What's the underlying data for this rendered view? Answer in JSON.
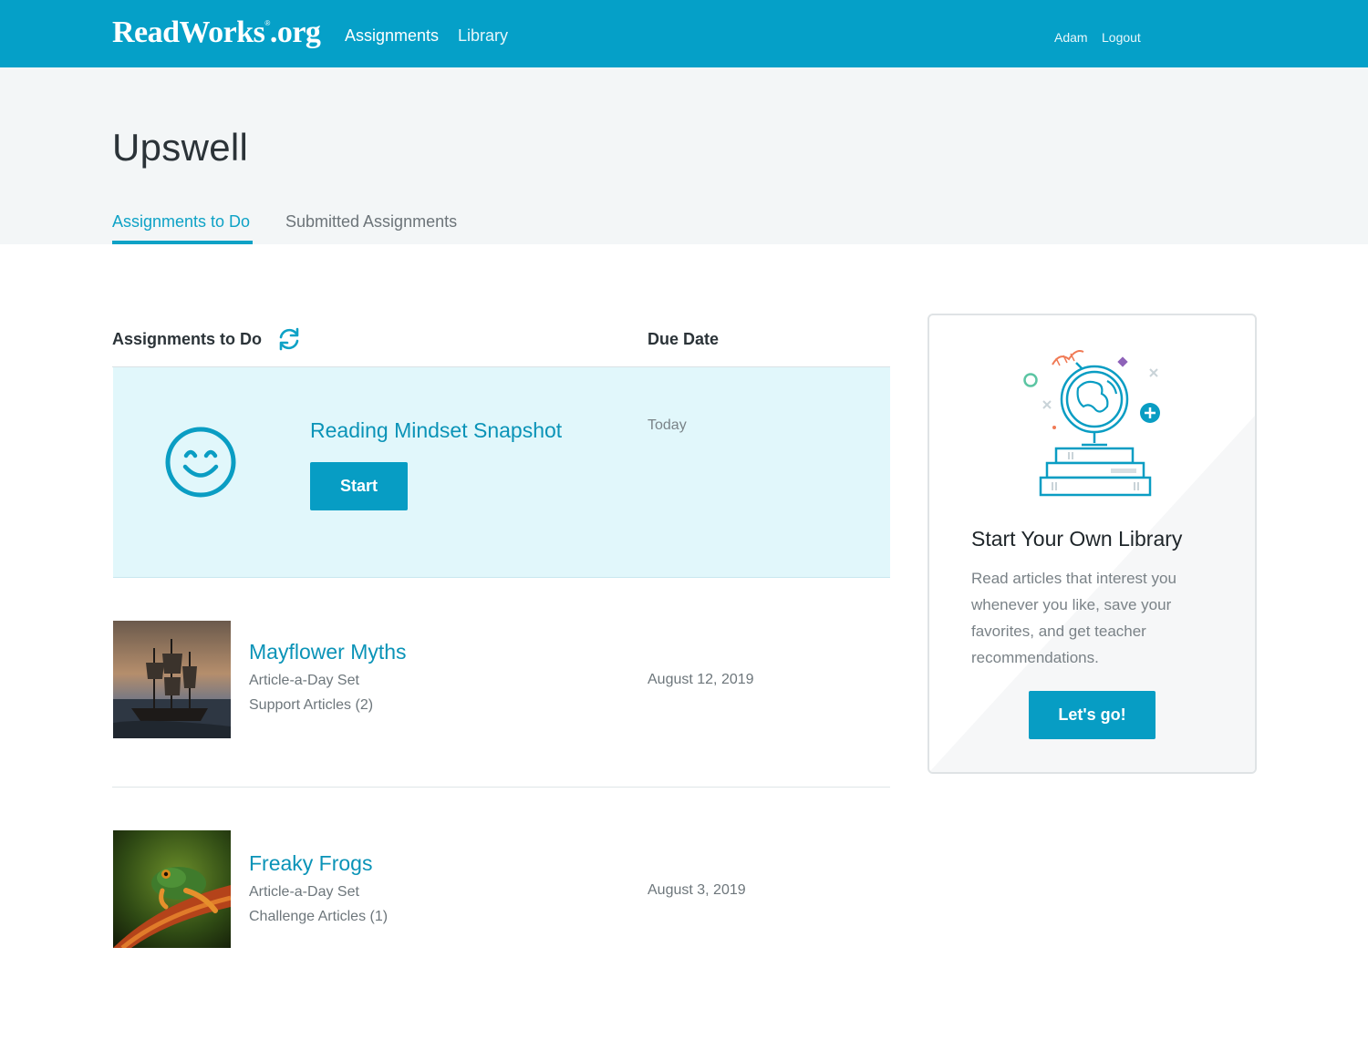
{
  "header": {
    "logo_text": "ReadWorks",
    "logo_reg": "®",
    "logo_suffix": ".org",
    "nav": {
      "assignments": "Assignments",
      "library": "Library"
    },
    "user": {
      "name": "Adam",
      "logout": "Logout"
    }
  },
  "page": {
    "title": "Upswell",
    "tabs": [
      {
        "label": "Assignments to Do",
        "active": true
      },
      {
        "label": "Submitted Assignments",
        "active": false
      }
    ]
  },
  "list": {
    "heading": "Assignments to Do",
    "due_heading": "Due Date",
    "featured": {
      "title": "Reading Mindset Snapshot",
      "button": "Start",
      "due": "Today",
      "icon": "smiley-face-icon"
    },
    "items": [
      {
        "title": "Mayflower Myths",
        "type": "Article-a-Day Set",
        "detail": "Support Articles (2)",
        "due": "August 12, 2019",
        "thumbnail": "ship-painting"
      },
      {
        "title": "Freaky Frogs",
        "type": "Article-a-Day Set",
        "detail": "Challenge Articles (1)",
        "due": "August 3, 2019",
        "thumbnail": "frog-photo"
      }
    ]
  },
  "sidebar_card": {
    "title": "Start Your Own Library",
    "text": "Read articles that interest you whenever you like, save your favorites, and get teacher recommendations.",
    "button": "Let's go!",
    "illustration": "globe-on-books-icon"
  },
  "colors": {
    "brand": "#05a0c8",
    "accent_text": "#0a93b7",
    "featured_bg": "#e1f7fb",
    "header_band": "#f3f6f7"
  }
}
